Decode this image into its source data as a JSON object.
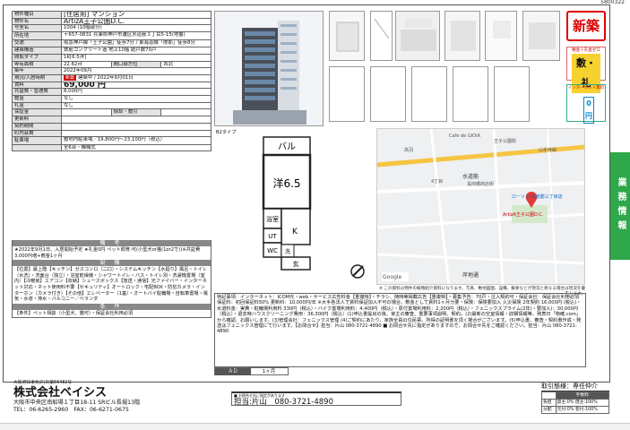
{
  "doc_id": "5800322",
  "spec": [
    {
      "k": "物件種目",
      "v": "[住居用] マンション",
      "style": "lg"
    },
    {
      "k": "物件名",
      "v": "ArtizA王子公園D.C.",
      "style": "lg"
    },
    {
      "k": "号室名",
      "v": "1004 (10階部分)"
    },
    {
      "k": "所在地",
      "v": "〒657-0831 兵庫県神戸市灘区水道筋３丁目5-15(地番)",
      "tall": true
    },
    {
      "k": "交通",
      "v": "阪急神戸線「王子公園」徒歩7分 / 東海道線「摩耶」徒歩8分",
      "tall": true
    },
    {
      "k": "建築構造",
      "v": "鉄筋コンクリート造 地上10階 総戸数70戸"
    },
    {
      "k": "間取タイプ",
      "v": "1K[6.5洋]"
    },
    {
      "k": "専有面積",
      "v": "22.62㎡",
      "k2": "間口部方位",
      "v2": "西北"
    },
    {
      "k": "築年",
      "v": "2022年09月"
    },
    {
      "k": "現況/入居時期",
      "v": "建築中 / 2022年9月01日",
      "badge": "新築"
    },
    {
      "k": "賃料",
      "v": "69,000 円",
      "style": "big"
    },
    {
      "k": "共益費・管理費",
      "v": "8,000円"
    },
    {
      "k": "敷金",
      "v": "なし"
    },
    {
      "k": "礼金",
      "v": "なし"
    },
    {
      "k": "保証金",
      "v": "",
      "k2": "償却・敷引",
      "v2": ""
    },
    {
      "k": "更新料",
      "v": ""
    },
    {
      "k": "契約期間",
      "v": ""
    },
    {
      "k": "町内会費",
      "v": ""
    },
    {
      "k": "駐車場",
      "v": "敷地内駐車場／19,800円〜23,100円（税込）",
      "tall": true
    },
    {
      "k": "",
      "v": "全6台・機械式"
    }
  ],
  "remarks_title": "備 考",
  "remarks": "★2022年9月1日、入居開始予定 ★礼金0円 ペット飼育:可(小型犬or猫(1or2で))※共益費3,000円増+敷金1ヶ月",
  "facilities_title": "設 備",
  "facilities": "【位置】最上階【キッチン】ガスコンロ（二口）・システムキッチン【水廻り】風呂・トイレ（水洗）・洗面台（独立）・浴室乾燥機・シャワートイレ・バス・トイレ別・洗濯機置場（室内）【冷暖房】エアコン【収納】シューズボックス【放送・通信】光ファイバー・インターネット対応・ネット使用料不要【セキュリティ】オートロック・宅配BOX・防犯カメラ・インターホン（カメラ付き）【その他】エレベーター（1基）・オートバイ駐輪場・自転車置場・電気・水道・排水・バルコニー／ベランダ",
  "conditions_title": "条 件",
  "conditions": "【条件】ペット相談（小型犬、猫可）・保証会社利用必須",
  "stamps": {
    "new": "新築",
    "zero_top": "敷金＋礼金ゼロ",
    "zero": "敷・礼",
    "net_top": "インターネット無料",
    "net": "0円"
  },
  "plan_label": "B2タイプ",
  "plan_rooms": {
    "balcony": "バル",
    "main": "洋6.5",
    "bath": "浴室",
    "laundry": "洗",
    "ut": "UT",
    "wc": "WC",
    "k": "K",
    "gen": "玄"
  },
  "map": {
    "labels": [
      "王子公園駅",
      "水道筋",
      "山手幹線",
      "ローソン 水道筋三丁目店",
      "ArtizA王子公園D.C.",
      "長田橋商店街",
      "Cafe de GIOIA",
      "高羽",
      "4丁目",
      "岸地通",
      "Google"
    ]
  },
  "map_note": "※ この資料は物件の概略紹介資料になります。写真、敷地図面、設備、概要などが現況と異なる場合は現況を優先します。",
  "desc": "特記事項：インターネット：ICOM光・web・サービス広告料金【重複特】・チラシ、随時等掲載広告【重複特】・募集予告：70戸・注入契約可・保証会社：保証会社利用必須 保証料：初回保証料50% 更新料：10,000円/年 ※大手各法人で賃料保証加入不可の場合、敷金として賃料1ヶ月分要・保険：保険要加入 火災保険 2年契約 16,000円 (税込)・水道料金：実費・駐輪場利用料 330円（税込）・バイク置場利用料：4,400円（税込）・原付置場利用料：2,200円（税込）・フェニックスプライム(2年)・要加入)：30,000円（税込）・退去時ハウスクリーニング費用：36,300円（税込）(1)申込書提出の後、家主の審査、重要事項説明、契約。(2)最新の空室情報・詳細情報等、発表日「物確.com」から確認、お願いします。(3)管理会社：フェニックス管理 (4)ご契約にあたり、家族全員の住民票、所得の証明書を頂く場合がございます。(5)申込書、審査・契約書作成・発送はフェニックス管理にて行います。【お問合せ】担当：片山 080-3721-4890 ■ お問合せ先に指定がありますので、お問合せ先をご確認ください。担当：片山 080-3721-4890",
  "ad": {
    "label": "ＡＤ",
    "value": "1ヶ月"
  },
  "side_tab": "業務情報",
  "company": {
    "license": "大阪府知事免許(3)第56482号",
    "name": "株式会社ベイシス",
    "address": "大阪市中央区南船場１丁目18-11 SRビル長堀13階",
    "tel": "TEL：06-6265-2960　FAX：06-6271-0675"
  },
  "contact": {
    "small": "■ お問合せ先に指定があります",
    "main": "担当:片山　080-3721-4890"
  },
  "deal": {
    "title": "取引態様：専任仲介",
    "fee_label": "手数料",
    "rows": [
      [
        "負担",
        "貸主:0% 借主:100%"
      ],
      [
        "分配",
        "元付:0% 客付:100%"
      ]
    ]
  },
  "colors": {
    "accent": "#2ea84a",
    "red": "#cc0000"
  }
}
